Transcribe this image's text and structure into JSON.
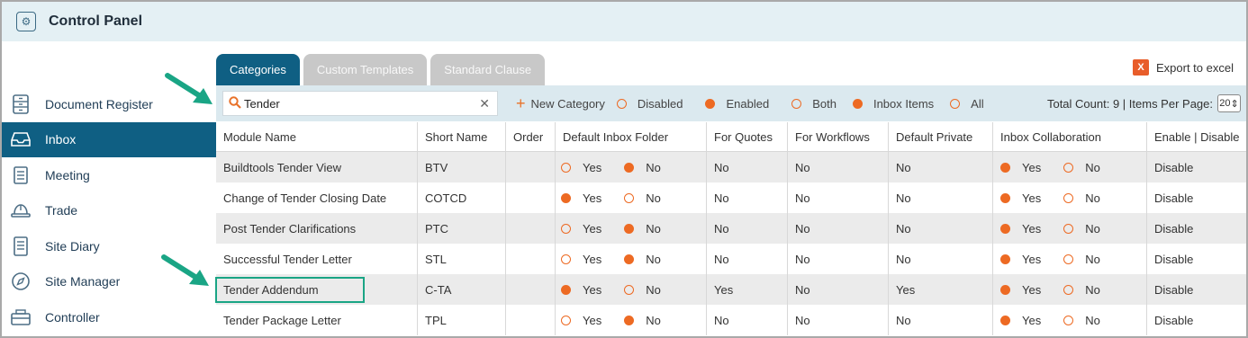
{
  "header": {
    "title": "Control Panel",
    "icon": "gear-box-icon"
  },
  "sidebar": {
    "items": [
      {
        "label": "Document Register",
        "icon": "document-register-icon",
        "active": false
      },
      {
        "label": "Inbox",
        "icon": "inbox-icon",
        "active": true
      },
      {
        "label": "Meeting",
        "icon": "meeting-icon",
        "active": false
      },
      {
        "label": "Trade",
        "icon": "hard-hat-icon",
        "active": false
      },
      {
        "label": "Site Diary",
        "icon": "diary-icon",
        "active": false
      },
      {
        "label": "Site Manager",
        "icon": "compass-icon",
        "active": false
      },
      {
        "label": "Controller",
        "icon": "controller-icon",
        "active": false
      }
    ]
  },
  "tabs": [
    {
      "label": "Categories",
      "active": true
    },
    {
      "label": "Custom Templates",
      "active": false
    },
    {
      "label": "Standard Clause",
      "active": false
    }
  ],
  "export": {
    "label": "Export to excel"
  },
  "toolbar": {
    "search_value": "Tender",
    "new_category": "New Category",
    "filters": [
      {
        "label": "Disabled",
        "selected": false
      },
      {
        "label": "Enabled",
        "selected": true
      },
      {
        "label": "Both",
        "selected": false
      },
      {
        "label": "Inbox Items",
        "selected": true
      },
      {
        "label": "All",
        "selected": false
      }
    ],
    "count_text": "Total Count: 9 | Items Per Page:",
    "per_page": "20"
  },
  "table": {
    "columns": [
      "Module Name",
      "Short Name",
      "Order",
      "Default Inbox Folder",
      "For Quotes",
      "For Workflows",
      "Default Private",
      "Inbox Collaboration",
      "Enable | Disable"
    ],
    "yes_label": "Yes",
    "no_label": "No",
    "rows": [
      {
        "module": "Buildtools Tender View",
        "short": "BTV",
        "order": "",
        "inbox_yes": false,
        "quotes": "No",
        "workflows": "No",
        "private": "No",
        "collab_yes": true,
        "action": "Disable"
      },
      {
        "module": "Change of Tender Closing Date",
        "short": "COTCD",
        "order": "",
        "inbox_yes": true,
        "quotes": "No",
        "workflows": "No",
        "private": "No",
        "collab_yes": true,
        "action": "Disable"
      },
      {
        "module": "Post Tender Clarifications",
        "short": "PTC",
        "order": "",
        "inbox_yes": false,
        "quotes": "No",
        "workflows": "No",
        "private": "No",
        "collab_yes": true,
        "action": "Disable"
      },
      {
        "module": "Successful Tender Letter",
        "short": "STL",
        "order": "",
        "inbox_yes": false,
        "quotes": "No",
        "workflows": "No",
        "private": "No",
        "collab_yes": true,
        "action": "Disable"
      },
      {
        "module": "Tender Addendum",
        "short": "C-TA",
        "order": "",
        "inbox_yes": true,
        "quotes": "Yes",
        "workflows": "No",
        "private": "Yes",
        "collab_yes": true,
        "action": "Disable"
      },
      {
        "module": "Tender Package Letter",
        "short": "TPL",
        "order": "",
        "inbox_yes": false,
        "quotes": "No",
        "workflows": "No",
        "private": "No",
        "collab_yes": true,
        "action": "Disable"
      }
    ]
  },
  "colors": {
    "accent": "#0f5f83",
    "radio": "#ed6a23",
    "annotation": "#1aa585"
  }
}
